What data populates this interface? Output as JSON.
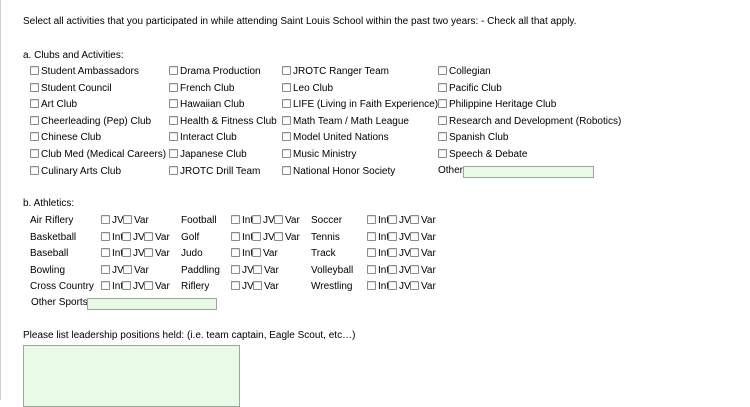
{
  "intro": "Select all activities that you participated in while attending Saint Louis School within the past two years: - Check all that apply.",
  "clubs": {
    "heading": "a. Clubs and Activities:",
    "columns": [
      [
        "Student Ambassadors",
        "Student Council",
        "Art Club",
        "Cheerleading (Pep) Club",
        "Chinese Club",
        "Club Med (Medical Careers)",
        "Culinary Arts Club"
      ],
      [
        "Drama Production",
        "French Club",
        "Hawaiian Club",
        "Health & Fitness Club",
        "Interact Club",
        "Japanese Club",
        "JROTC Drill Team"
      ],
      [
        "JROTC Ranger Team",
        "Leo Club",
        "LIFE (Living in Faith Experience)",
        "Math Team / Math League",
        "Model United Nations",
        "Music Ministry",
        "National Honor Society"
      ],
      [
        "Collegian",
        "Pacific Club",
        "Philippine Heritage Club",
        "Research and Development (Robotics)",
        "Spanish Club",
        "Speech & Debate"
      ]
    ],
    "other_label": "Other",
    "other_value": ""
  },
  "athletics": {
    "heading": "b. Athletics:",
    "columns": [
      [
        {
          "name": "Air Riflery",
          "levels": [
            "JV",
            "Var"
          ]
        },
        {
          "name": "Basketball",
          "levels": [
            "Int",
            "JV",
            "Var"
          ]
        },
        {
          "name": "Baseball",
          "levels": [
            "Int",
            "JV",
            "Var"
          ]
        },
        {
          "name": "Bowling",
          "levels": [
            "JV",
            "Var"
          ]
        },
        {
          "name": "Cross Country",
          "levels": [
            "Int",
            "JV",
            "Var"
          ]
        }
      ],
      [
        {
          "name": "Football",
          "levels": [
            "Int",
            "JV",
            "Var"
          ]
        },
        {
          "name": "Golf",
          "levels": [
            "Int",
            "JV",
            "Var"
          ]
        },
        {
          "name": "Judo",
          "levels": [
            "Int",
            "Var"
          ]
        },
        {
          "name": "Paddling",
          "levels": [
            "JV",
            "Var"
          ]
        },
        {
          "name": "Riflery",
          "levels": [
            "JV",
            "Var"
          ]
        }
      ],
      [
        {
          "name": "Soccer",
          "levels": [
            "Int",
            "JV",
            "Var"
          ]
        },
        {
          "name": "Tennis",
          "levels": [
            "Int",
            "JV",
            "Var"
          ]
        },
        {
          "name": "Track",
          "levels": [
            "Int",
            "JV",
            "Var"
          ]
        },
        {
          "name": "Volleyball",
          "levels": [
            "Int",
            "JV",
            "Var"
          ]
        },
        {
          "name": "Wrestling",
          "levels": [
            "Int",
            "JV",
            "Var"
          ]
        }
      ]
    ],
    "other_label": "Other Sports",
    "other_value": ""
  },
  "leadership": {
    "label": "Please list leadership positions held: (i.e. team captain, Eagle Scout, etc…)",
    "value": ""
  },
  "colors": {
    "field_bg": "#e9fae6",
    "field_border": "#9aa79a"
  }
}
